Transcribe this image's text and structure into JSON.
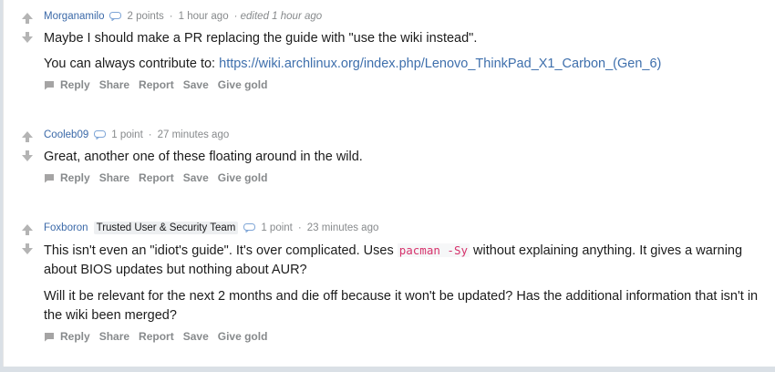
{
  "icons": {
    "upvote": "arrow-up-icon",
    "downvote": "arrow-down-icon",
    "chat": "chat-bubble-icon",
    "reply": "comment-icon"
  },
  "colors": {
    "author": "#3b69a8",
    "link": "#3e6fac",
    "code": "#d6336c",
    "meta": "#878a8c",
    "background": "#dae0e6"
  },
  "comments": [
    {
      "author": "Morganamilo",
      "points": "2 points",
      "sep1": "·",
      "time": "1 hour ago",
      "edited": "· edited 1 hour ago",
      "para1": "Maybe I should make a PR replacing the guide with \"use the wiki instead\".",
      "para2_prefix": "You can always contribute to: ",
      "para2_link": "https://wiki.archlinux.org/index.php/Lenovo_ThinkPad_X1_Carbon_(Gen_6)"
    },
    {
      "author": "Cooleb09",
      "points": "1 point",
      "sep1": "·",
      "time": "27 minutes ago",
      "para1": "Great, another one of these floating around in the wild."
    },
    {
      "author": "Foxboron",
      "flair": "Trusted User & Security Team",
      "points": "1 point",
      "sep1": "·",
      "time": "23 minutes ago",
      "para1_a": "This isn't even an \"idiot's guide\". It's over complicated. Uses ",
      "para1_code": "pacman -Sy",
      "para1_b": " without explaining anything. It gives a warning about BIOS updates but nothing about AUR?",
      "para2": "Will it be relevant for the next 2 months and die off because it won't be updated? Has the additional information that isn't in the wiki been merged?"
    }
  ],
  "actions": {
    "reply": "Reply",
    "share": "Share",
    "report": "Report",
    "save": "Save",
    "gold": "Give gold"
  }
}
